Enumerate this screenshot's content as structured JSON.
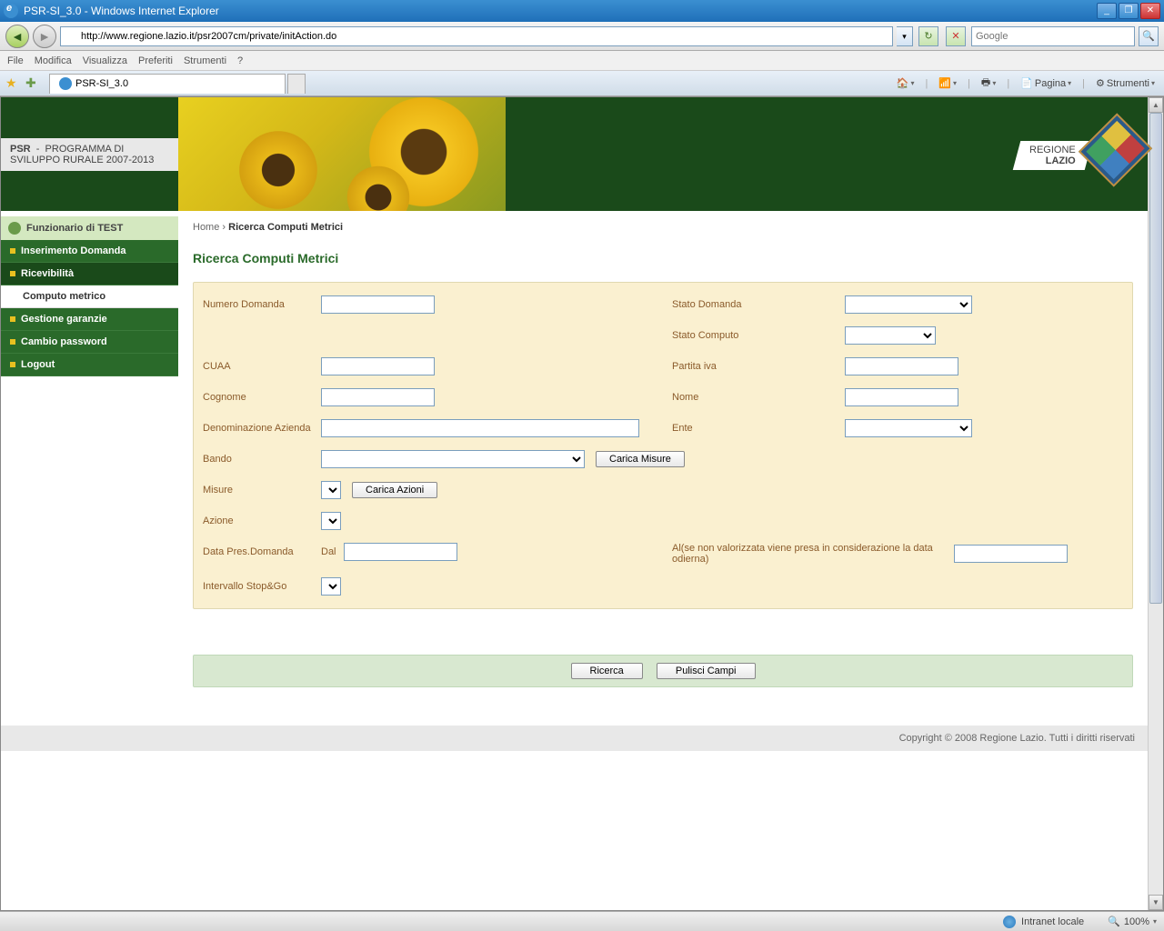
{
  "window": {
    "title": "PSR-SI_3.0 - Windows Internet Explorer",
    "url": "http://www.regione.lazio.it/psr2007cm/private/initAction.do",
    "search_placeholder": "Google",
    "tab_title": "PSR-SI_3.0"
  },
  "menus": {
    "file": "File",
    "modifica": "Modifica",
    "visualizza": "Visualizza",
    "preferiti": "Preferiti",
    "strumenti": "Strumenti",
    "help": "?"
  },
  "toolbar": {
    "pagina": "Pagina",
    "strumenti": "Strumenti"
  },
  "banner": {
    "psr": "PSR",
    "dash": "-",
    "programma": "PROGRAMMA DI",
    "sviluppo": "SVILUPPO RURALE 2007-2013",
    "regione": "REGIONE",
    "lazio": "LAZIO"
  },
  "sidebar": {
    "user_label": "Funzionario di TEST",
    "items": [
      {
        "label": "Inserimento Domanda"
      },
      {
        "label": "Ricevibilità"
      },
      {
        "label": "Computo metrico",
        "sub": true
      },
      {
        "label": "Gestione garanzie"
      },
      {
        "label": "Cambio password"
      },
      {
        "label": "Logout"
      }
    ]
  },
  "breadcrumb": {
    "home": "Home",
    "sep": "›",
    "current": "Ricerca Computi Metrici"
  },
  "page_title": "Ricerca Computi Metrici",
  "form": {
    "numero_domanda": "Numero Domanda",
    "stato_domanda": "Stato Domanda",
    "stato_computo": "Stato Computo",
    "cuaa": "CUAA",
    "partita_iva": "Partita iva",
    "cognome": "Cognome",
    "nome": "Nome",
    "denominazione": "Denominazione Azienda",
    "ente": "Ente",
    "bando": "Bando",
    "carica_misure": "Carica Misure",
    "misure": "Misure",
    "carica_azioni": "Carica Azioni",
    "azione": "Azione",
    "data_pres": "Data Pres.Domanda",
    "dal": "Dal",
    "al": "Al(se non valorizzata viene presa in considerazione la data odierna)",
    "intervallo": "Intervallo Stop&Go"
  },
  "actions": {
    "ricerca": "Ricerca",
    "pulisci": "Pulisci Campi"
  },
  "footer": "Copyright © 2008 Regione Lazio. Tutti i diritti riservati",
  "statusbar": {
    "zone": "Intranet locale",
    "zoom": "100%"
  }
}
